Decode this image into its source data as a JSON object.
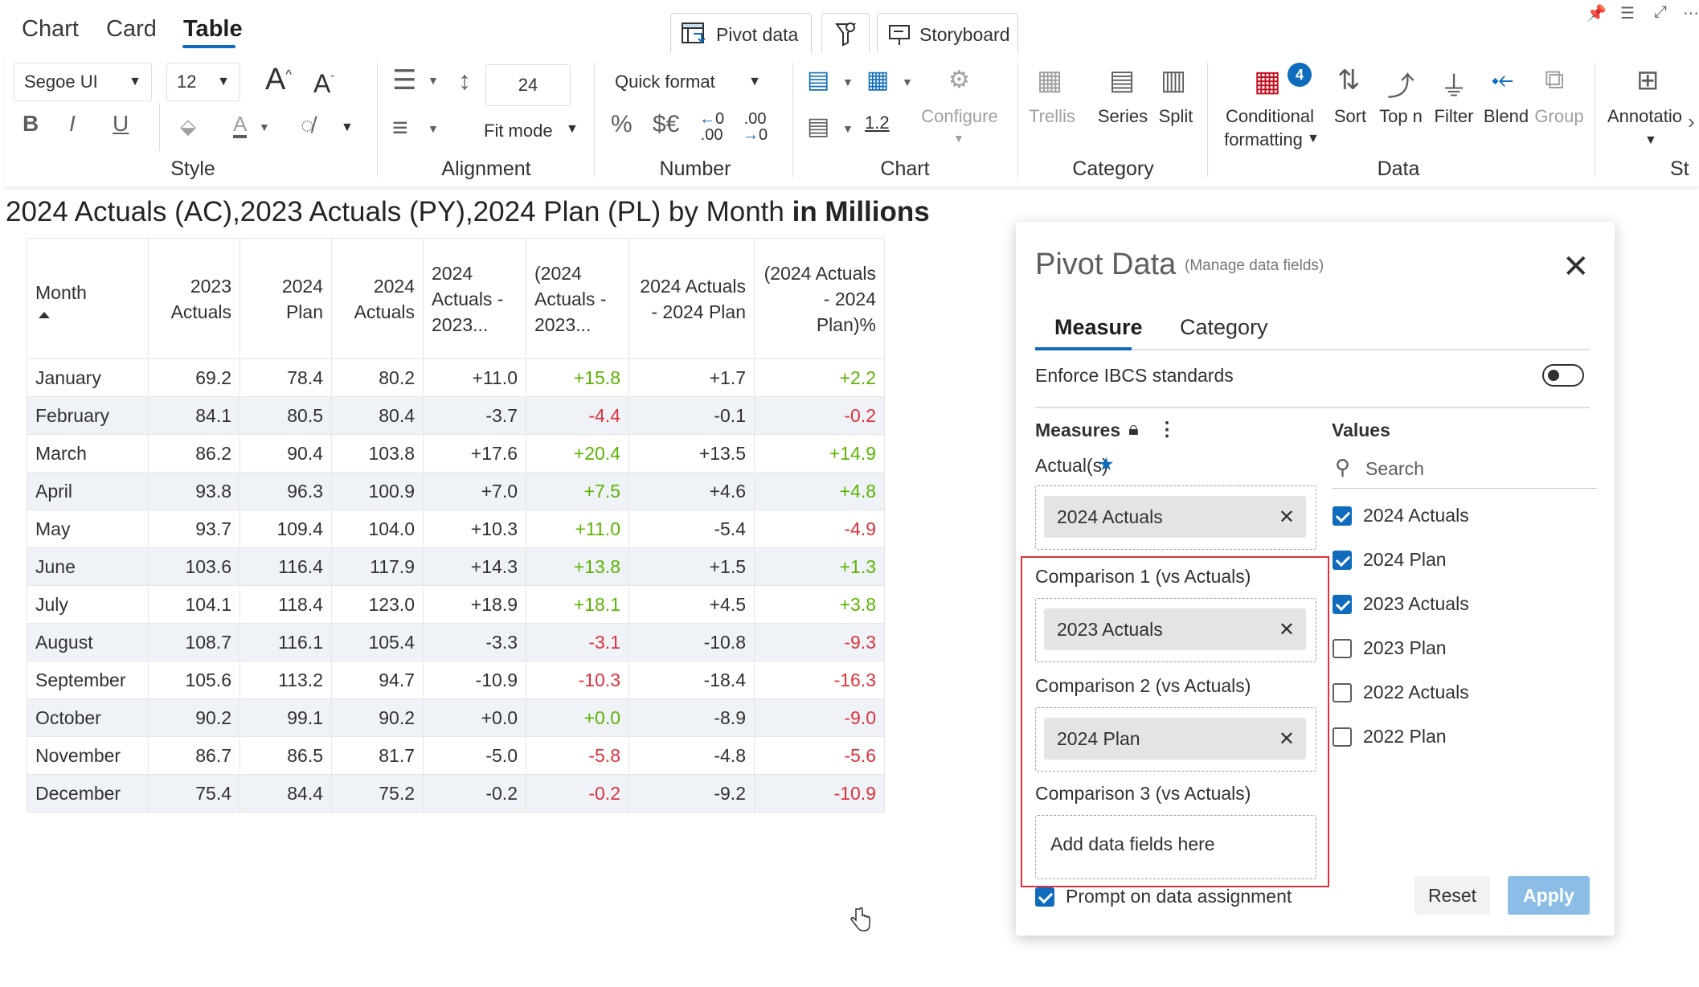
{
  "top_tabs": [
    "Chart",
    "Card",
    "Table"
  ],
  "top_buttons": {
    "pivot": "Pivot data",
    "storyboard": "Storyboard"
  },
  "ribbon": {
    "font_family": "Segoe UI",
    "font_size": "12",
    "row_height": "24",
    "quick_format": "Quick format",
    "fit_mode": "Fit mode",
    "decimal_dec": ".00",
    "decimal_inc": ".00",
    "scale_value": "1.2",
    "configure": "Configure",
    "trellis": "Trellis",
    "series": "Series",
    "split": "Split",
    "conditional_formatting_1": "Conditional",
    "conditional_formatting_2": "formatting",
    "conditional_badge": "4",
    "sort": "Sort",
    "top_n": "Top n",
    "filter": "Filter",
    "blend": "Blend",
    "group": "Group",
    "annotation": "Annotatio",
    "groups": {
      "style": "Style",
      "alignment": "Alignment",
      "number": "Number",
      "chart": "Chart",
      "category": "Category",
      "data": "Data",
      "cut": "St"
    }
  },
  "title": {
    "measures": "2024 Actuals (AC),2023 Actuals (PY),2024 Plan (PL)",
    "by": "by Month",
    "unit": "in Millions"
  },
  "table": {
    "headers": [
      [
        "Month"
      ],
      [
        "2023",
        "Actuals"
      ],
      [
        "2024",
        "Plan"
      ],
      [
        "2024",
        "Actuals"
      ],
      [
        "2024",
        "Actuals -",
        "2023..."
      ],
      [
        "(2024",
        "Actuals -",
        "2023..."
      ],
      [
        "2024 Actuals",
        "- 2024 Plan"
      ],
      [
        "(2024 Actuals",
        "- 2024",
        "Plan)%"
      ]
    ],
    "rows": [
      [
        "January",
        "69.2",
        "78.4",
        "80.2",
        "+11.0",
        "+15.8",
        "+1.7",
        "+2.2"
      ],
      [
        "February",
        "84.1",
        "80.5",
        "80.4",
        "-3.7",
        "-4.4",
        "-0.1",
        "-0.2"
      ],
      [
        "March",
        "86.2",
        "90.4",
        "103.8",
        "+17.6",
        "+20.4",
        "+13.5",
        "+14.9"
      ],
      [
        "April",
        "93.8",
        "96.3",
        "100.9",
        "+7.0",
        "+7.5",
        "+4.6",
        "+4.8"
      ],
      [
        "May",
        "93.7",
        "109.4",
        "104.0",
        "+10.3",
        "+11.0",
        "-5.4",
        "-4.9"
      ],
      [
        "June",
        "103.6",
        "116.4",
        "117.9",
        "+14.3",
        "+13.8",
        "+1.5",
        "+1.3"
      ],
      [
        "July",
        "104.1",
        "118.4",
        "123.0",
        "+18.9",
        "+18.1",
        "+4.5",
        "+3.8"
      ],
      [
        "August",
        "108.7",
        "116.1",
        "105.4",
        "-3.3",
        "-3.1",
        "-10.8",
        "-9.3"
      ],
      [
        "September",
        "105.6",
        "113.2",
        "94.7",
        "-10.9",
        "-10.3",
        "-18.4",
        "-16.3"
      ],
      [
        "October",
        "90.2",
        "99.1",
        "90.2",
        "+0.0",
        "+0.0",
        "-8.9",
        "-9.0"
      ],
      [
        "November",
        "86.7",
        "86.5",
        "81.7",
        "-5.0",
        "-5.8",
        "-4.8",
        "-5.6"
      ],
      [
        "December",
        "75.4",
        "84.4",
        "75.2",
        "-0.2",
        "-0.2",
        "-9.2",
        "-10.9"
      ]
    ],
    "colors": {
      "positive": "#5ab400",
      "negative": "#e0313a"
    }
  },
  "panel": {
    "title": "Pivot Data",
    "subtitle": "(Manage data fields)",
    "tabs": [
      "Measure",
      "Category"
    ],
    "enforce_label": "Enforce IBCS standards",
    "measures_label": "Measures",
    "values_label": "Values",
    "actuals_label": "Actual(s)",
    "actuals_chip": "2024 Actuals",
    "comp1_label": "Comparison 1 (vs Actuals)",
    "comp1_chip": "2023 Actuals",
    "comp2_label": "Comparison 2 (vs Actuals)",
    "comp2_chip": "2024 Plan",
    "comp3_label": "Comparison 3 (vs Actuals)",
    "comp3_placeholder": "Add data fields here",
    "search_placeholder": "Search",
    "values": [
      {
        "label": "2024 Actuals",
        "checked": true
      },
      {
        "label": "2024 Plan",
        "checked": true
      },
      {
        "label": "2023 Actuals",
        "checked": true
      },
      {
        "label": "2023 Plan",
        "checked": false
      },
      {
        "label": "2022 Actuals",
        "checked": false
      },
      {
        "label": "2022 Plan",
        "checked": false
      }
    ],
    "prompt_label": "Prompt on data assignment",
    "reset": "Reset",
    "apply": "Apply"
  }
}
